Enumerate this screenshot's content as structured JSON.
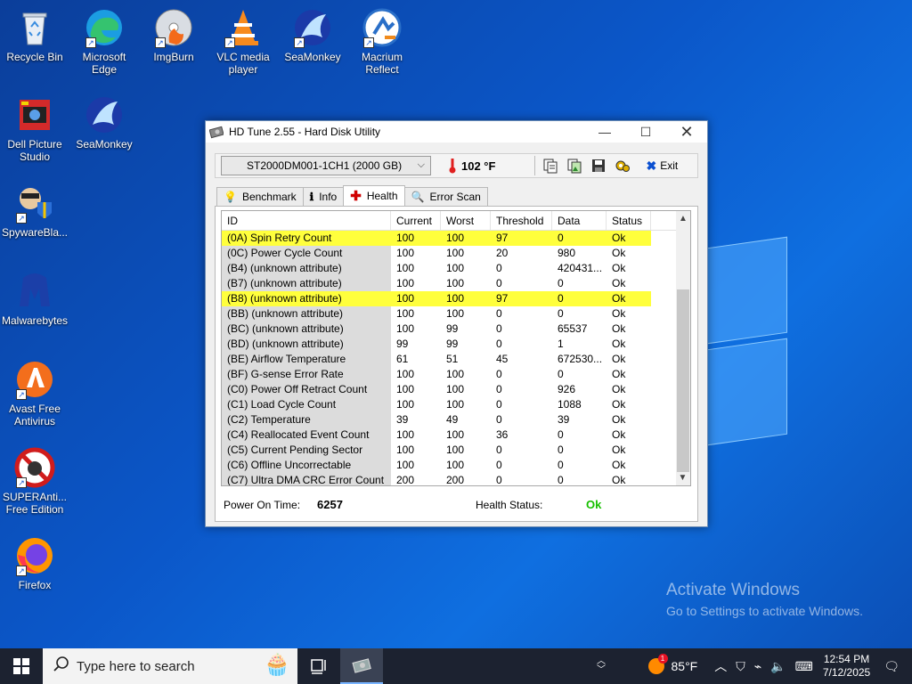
{
  "desktop": {
    "icons": [
      {
        "label": "Recycle Bin",
        "icon": "recycle-bin-icon"
      },
      {
        "label": "Microsoft Edge",
        "icon": "edge-icon"
      },
      {
        "label": "ImgBurn",
        "icon": "imgburn-icon"
      },
      {
        "label": "VLC media player",
        "icon": "vlc-icon"
      },
      {
        "label": "SeaMonkey",
        "icon": "seamonkey-icon"
      },
      {
        "label": "Macrium Reflect",
        "icon": "macrium-icon"
      },
      {
        "label": "Dell Picture Studio",
        "icon": "dell-picture-studio-icon"
      },
      {
        "label": "SeaMonkey",
        "icon": "seamonkey-icon"
      },
      {
        "label": "SpywareBla...",
        "icon": "spywareblaster-icon"
      },
      {
        "label": "Malwarebytes",
        "icon": "malwarebytes-icon"
      },
      {
        "label": "Avast Free Antivirus",
        "icon": "avast-icon"
      },
      {
        "label": "SUPERAnti... Free Edition",
        "icon": "superantispyware-icon"
      },
      {
        "label": "Firefox",
        "icon": "firefox-icon"
      }
    ],
    "watermark": {
      "line1": "Activate Windows",
      "line2": "Go to Settings to activate Windows."
    }
  },
  "window": {
    "title": "HD Tune 2.55 - Hard Disk Utility",
    "drive": "ST2000DM001-1CH1 (2000 GB)",
    "temperature": "102 °F",
    "exit_label": "Exit",
    "tabs": [
      {
        "label": "Benchmark",
        "icon": "benchmark-icon"
      },
      {
        "label": "Info",
        "icon": "info-icon"
      },
      {
        "label": "Health",
        "icon": "health-icon"
      },
      {
        "label": "Error Scan",
        "icon": "error-scan-icon"
      }
    ],
    "columns": [
      "ID",
      "Current",
      "Worst",
      "Threshold",
      "Data",
      "Status"
    ],
    "rows": [
      {
        "id": "(0A) Spin Retry Count",
        "current": "100",
        "worst": "100",
        "threshold": "97",
        "data": "0",
        "status": "Ok",
        "warn": true
      },
      {
        "id": "(0C) Power Cycle Count",
        "current": "100",
        "worst": "100",
        "threshold": "20",
        "data": "980",
        "status": "Ok",
        "warn": false
      },
      {
        "id": "(B4) (unknown attribute)",
        "current": "100",
        "worst": "100",
        "threshold": "0",
        "data": "420431...",
        "status": "Ok",
        "warn": false
      },
      {
        "id": "(B7) (unknown attribute)",
        "current": "100",
        "worst": "100",
        "threshold": "0",
        "data": "0",
        "status": "Ok",
        "warn": false
      },
      {
        "id": "(B8) (unknown attribute)",
        "current": "100",
        "worst": "100",
        "threshold": "97",
        "data": "0",
        "status": "Ok",
        "warn": true
      },
      {
        "id": "(BB) (unknown attribute)",
        "current": "100",
        "worst": "100",
        "threshold": "0",
        "data": "0",
        "status": "Ok",
        "warn": false
      },
      {
        "id": "(BC) (unknown attribute)",
        "current": "100",
        "worst": "99",
        "threshold": "0",
        "data": "65537",
        "status": "Ok",
        "warn": false
      },
      {
        "id": "(BD) (unknown attribute)",
        "current": "99",
        "worst": "99",
        "threshold": "0",
        "data": "1",
        "status": "Ok",
        "warn": false
      },
      {
        "id": "(BE) Airflow Temperature",
        "current": "61",
        "worst": "51",
        "threshold": "45",
        "data": "672530...",
        "status": "Ok",
        "warn": false
      },
      {
        "id": "(BF) G-sense Error Rate",
        "current": "100",
        "worst": "100",
        "threshold": "0",
        "data": "0",
        "status": "Ok",
        "warn": false
      },
      {
        "id": "(C0) Power Off Retract Count",
        "current": "100",
        "worst": "100",
        "threshold": "0",
        "data": "926",
        "status": "Ok",
        "warn": false
      },
      {
        "id": "(C1) Load Cycle Count",
        "current": "100",
        "worst": "100",
        "threshold": "0",
        "data": "1088",
        "status": "Ok",
        "warn": false
      },
      {
        "id": "(C2) Temperature",
        "current": "39",
        "worst": "49",
        "threshold": "0",
        "data": "39",
        "status": "Ok",
        "warn": false
      },
      {
        "id": "(C4) Reallocated Event Count",
        "current": "100",
        "worst": "100",
        "threshold": "36",
        "data": "0",
        "status": "Ok",
        "warn": false
      },
      {
        "id": "(C5) Current Pending Sector",
        "current": "100",
        "worst": "100",
        "threshold": "0",
        "data": "0",
        "status": "Ok",
        "warn": false
      },
      {
        "id": "(C6) Offline Uncorrectable",
        "current": "100",
        "worst": "100",
        "threshold": "0",
        "data": "0",
        "status": "Ok",
        "warn": false
      },
      {
        "id": "(C7) Ultra DMA CRC Error Count",
        "current": "200",
        "worst": "200",
        "threshold": "0",
        "data": "0",
        "status": "Ok",
        "warn": false
      }
    ],
    "footer": {
      "power_on_label": "Power On Time:",
      "power_on_value": "6257",
      "health_label": "Health Status:",
      "health_value": "Ok"
    }
  },
  "taskbar": {
    "search_placeholder": "Type here to search",
    "weather": "85°F",
    "time": "12:54 PM",
    "date": "7/12/2025"
  },
  "colors": {
    "warn_row": "#ffff3c",
    "health_ok": "#17c000",
    "taskbar": "#1c2230"
  }
}
